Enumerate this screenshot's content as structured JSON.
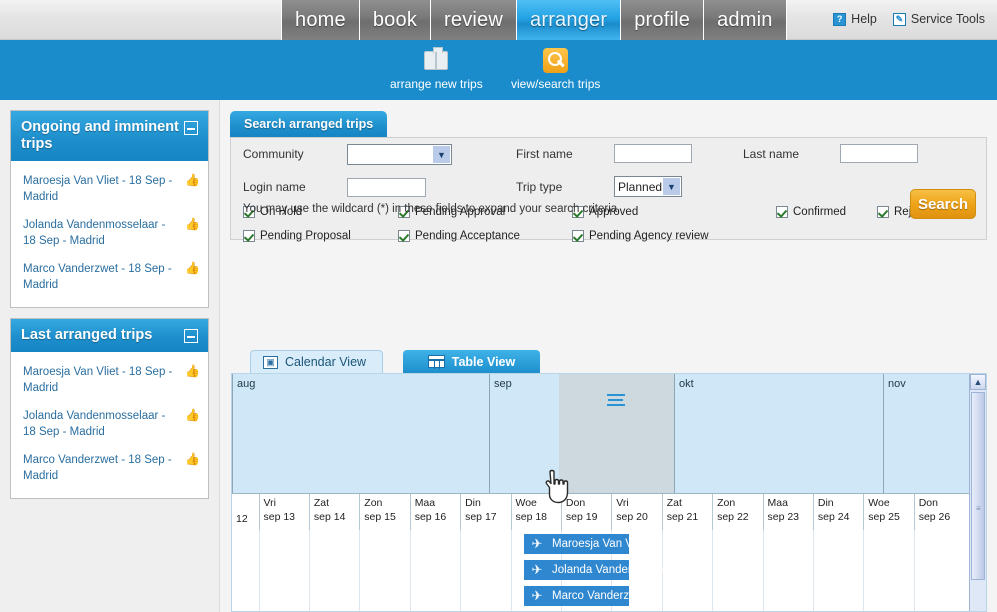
{
  "nav": {
    "tabs": [
      {
        "label": "home",
        "active": false
      },
      {
        "label": "book",
        "active": false
      },
      {
        "label": "review",
        "active": false
      },
      {
        "label": "arranger",
        "active": true
      },
      {
        "label": "profile",
        "active": false
      },
      {
        "label": "admin",
        "active": false
      }
    ],
    "help_label": "Help",
    "help_icon": "question-mark-icon",
    "service_tools_label": "Service Tools",
    "service_tools_icon": "pencil-square-icon"
  },
  "toolbar": {
    "arrange_label": "arrange new trips",
    "arrange_icon": "briefcase-icon",
    "view_label": "view/search trips",
    "view_icon": "magnifier-icon",
    "band_color": "#1b8ccb"
  },
  "sidebar": {
    "panels": [
      {
        "title": "Ongoing and imminent trips",
        "collapse_icon": "collapse-box-icon",
        "items": [
          {
            "text": "Maroesja Van Vliet - 18 Sep - Madrid",
            "icon": "thumbs-up-icon"
          },
          {
            "text": "Jolanda Vandenmosselaar - 18 Sep - Madrid",
            "icon": "thumbs-up-icon"
          },
          {
            "text": "Marco Vanderzwet - 18 Sep - Madrid",
            "icon": "thumbs-up-icon"
          }
        ]
      },
      {
        "title": "Last arranged trips",
        "collapse_icon": "collapse-box-icon",
        "items": [
          {
            "text": "Maroesja Van Vliet - 18 Sep - Madrid",
            "icon": "thumbs-up-icon"
          },
          {
            "text": "Jolanda Vandenmosselaar - 18 Sep - Madrid",
            "icon": "thumbs-up-icon"
          },
          {
            "text": "Marco Vanderzwet - 18 Sep - Madrid",
            "icon": "thumbs-up-icon"
          }
        ]
      }
    ]
  },
  "main": {
    "tab_label": "Search arranged trips",
    "form": {
      "community_label": "Community",
      "community_value": "",
      "login_label": "Login name",
      "login_value": "",
      "first_name_label": "First name",
      "first_name_value": "",
      "last_name_label": "Last name",
      "last_name_value": "",
      "trip_type_label": "Trip type",
      "trip_type_value": "Planned"
    },
    "checkboxes": [
      {
        "label": "On Hold",
        "checked": true
      },
      {
        "label": "Pending Approval",
        "checked": true
      },
      {
        "label": "Approved",
        "checked": true
      },
      {
        "label": "Confirmed",
        "checked": true
      },
      {
        "label": "Rejected",
        "checked": true
      },
      {
        "label": "Pending Proposal",
        "checked": true
      },
      {
        "label": "Pending Acceptance",
        "checked": true
      },
      {
        "label": "Pending Agency review",
        "checked": true
      }
    ],
    "wildcard_hint": "You may use the wildcard (*) in these fields to expand your search criteria",
    "search_button": "Search",
    "search_button_color": "#efa419"
  },
  "views": {
    "calendar_tab": "Calendar View",
    "calendar_icon": "calendar-icon",
    "table_tab": "Table View",
    "table_icon": "grid-icon",
    "active_tab": "Table View"
  },
  "calendar": {
    "months": [
      "aug",
      "sep",
      "okt",
      "nov"
    ],
    "week_number": "12",
    "handle_icon": "drag-handle-icon",
    "days": [
      {
        "dow": "Vri",
        "date": "sep 13"
      },
      {
        "dow": "Zat",
        "date": "sep 14"
      },
      {
        "dow": "Zon",
        "date": "sep 15"
      },
      {
        "dow": "Maa",
        "date": "sep 16"
      },
      {
        "dow": "Din",
        "date": "sep 17"
      },
      {
        "dow": "Woe",
        "date": "sep 18"
      },
      {
        "dow": "Don",
        "date": "sep 19"
      },
      {
        "dow": "Vri",
        "date": "sep 20"
      },
      {
        "dow": "Zat",
        "date": "sep 21"
      },
      {
        "dow": "Zon",
        "date": "sep 22"
      },
      {
        "dow": "Maa",
        "date": "sep 23"
      },
      {
        "dow": "Din",
        "date": "sep 24"
      },
      {
        "dow": "Woe",
        "date": "sep 25"
      },
      {
        "dow": "Don",
        "date": "sep 26"
      }
    ],
    "trips": [
      {
        "label": "Maroesja Van Vliet",
        "icon": "airplane-icon"
      },
      {
        "label": "Jolanda Vandenmosselaar",
        "icon": "airplane-icon"
      },
      {
        "label": "Marco Vanderzwet",
        "icon": "airplane-icon"
      }
    ],
    "bar_color": "#2f87d0",
    "scroll_up_icon": "chevron-up-icon"
  },
  "cursor": {
    "icon": "pointing-hand-cursor"
  }
}
